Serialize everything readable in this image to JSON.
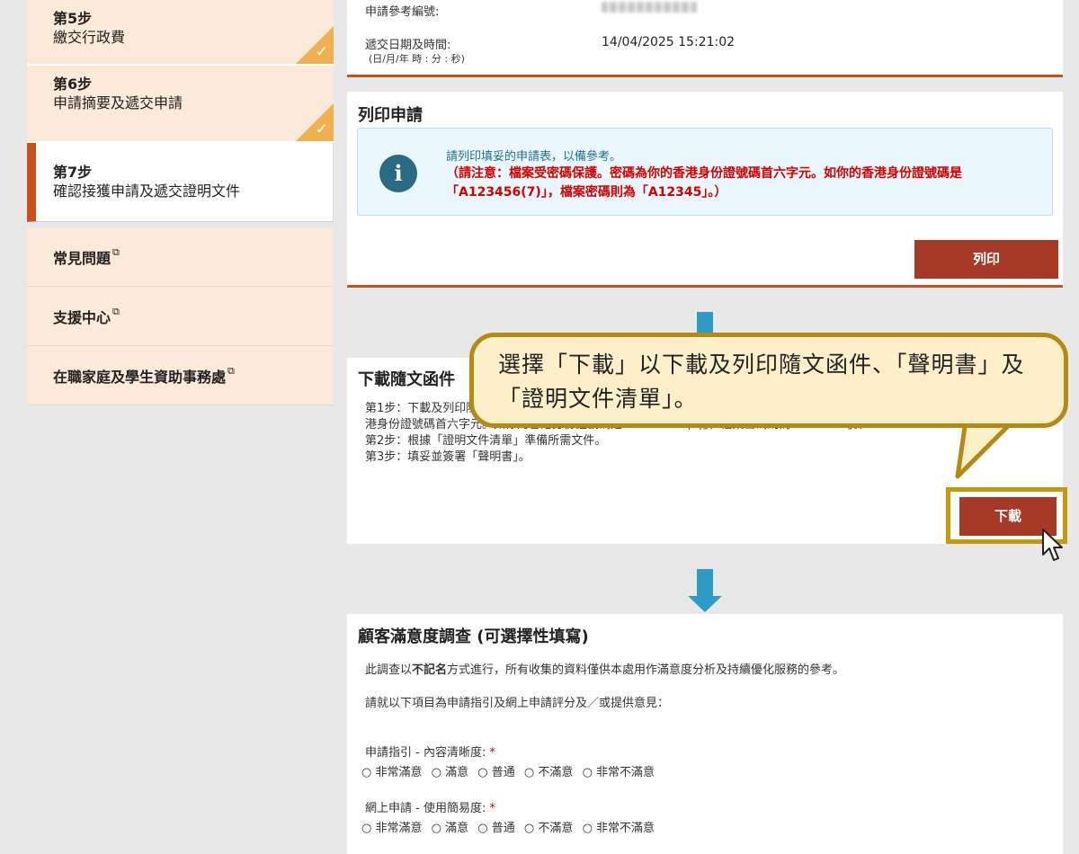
{
  "sidebar": {
    "steps": [
      {
        "num": "第5步",
        "desc": "繳交行政費",
        "done": true
      },
      {
        "num": "第6步",
        "desc": "申請摘要及遞交申請",
        "done": true
      },
      {
        "num": "第7步",
        "desc": "確認接獲申請及遞交證明文件",
        "current": true
      }
    ],
    "links": [
      {
        "label": "常見問題"
      },
      {
        "label": "支援中心"
      },
      {
        "label": "在職家庭及學生資助事務處"
      }
    ],
    "ext_symbol": "⧉"
  },
  "summary": {
    "ref_label": "申請參考編號:",
    "submit_label": "遞交日期及時間:",
    "submit_format": "(日/月/年 時 : 分 : 秒)",
    "submit_value": "14/04/2025 15:21:02"
  },
  "print": {
    "title": "列印申請",
    "info_line1": "請列印填妥的申請表，以備參考。",
    "info_line2": "（請注意：檔案受密碼保護。密碼為你的香港身份證號碼首六字元。如你的香港身份證號碼是「A123456(7)」，檔案密碼則為「A12345」。）",
    "button": "列印"
  },
  "download": {
    "title": "下載隨文函件",
    "step1": "第1步：下載及列印隨文函件、「聲明書」及「證明文件清單」。（請注意：檔案受密碼保護。密碼為你的香",
    "step1b": "港身份證號碼首六字元。如你的香港身份證號碼是「A123456(7)」，檔案密碼則為「A12345」。）",
    "step2": "第2步：根據「證明文件清單」準備所需文件。",
    "step3": "第3步：填妥並簽署「聲明書」。",
    "button": "下載"
  },
  "callout": {
    "line1": "選擇「下載」以下載及列印隨文函件、「聲明書」及",
    "line2": "「證明文件清單」。"
  },
  "survey": {
    "title": "顧客滿意度調查 (可選擇性填寫)",
    "intro_pre": "此調查以",
    "intro_bold": "不記名",
    "intro_post": "方式進行，所有收集的資料僅供本處用作滿意度分析及持續優化服務的參考。",
    "instruction": "請就以下項目為申請指引及網上申請評分及／或提供意見：",
    "q1": "申請指引 - 內容清晰度: ",
    "q2": "網上申請 - 使用簡易度: ",
    "required_mark": "*",
    "options": [
      "非常滿意",
      "滿意",
      "普通",
      "不滿意",
      "非常不滿意"
    ]
  }
}
